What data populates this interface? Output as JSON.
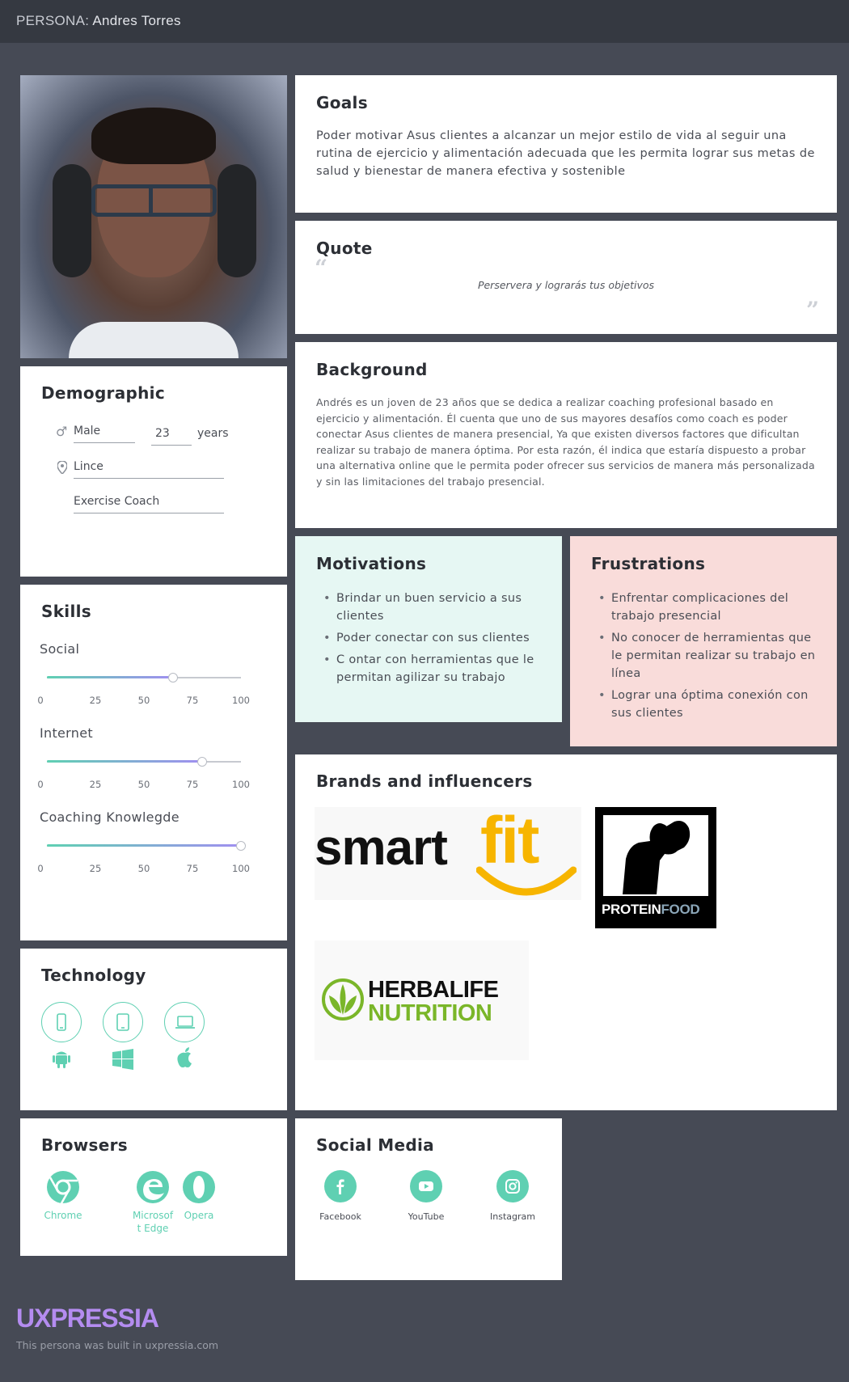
{
  "header": {
    "prefix": "PERSONA:",
    "name": "Andres Torres"
  },
  "goals": {
    "title": "Goals",
    "text": "Poder motivar Asus clientes a alcanzar un mejor estilo de vida al seguir una rutina de ejercicio y alimentación adecuada que les permita lograr sus metas de salud y bienestar de manera efectiva y sostenible"
  },
  "quote": {
    "title": "Quote",
    "text": "Perservera y  lograrás tus objetivos"
  },
  "background": {
    "title": "Background",
    "text": "Andrés es un joven de 23 años que se dedica a realizar coaching profesional basado en ejercicio y alimentación. Él cuenta que uno de sus mayores desafíos como coach es poder conectar Asus clientes de manera presencial, Ya que existen diversos factores que dificultan realizar su trabajo de manera óptima. Por esta razón, él indica que estaría dispuesto a probar una alternativa online que le permita poder ofrecer sus servicios de manera más personalizada y sin las limitaciones del trabajo presencial."
  },
  "demographic": {
    "title": "Demographic",
    "gender": "Male",
    "age": "23",
    "age_unit": "years",
    "location": "Lince",
    "occupation": "Exercise Coach"
  },
  "skills": {
    "title": "Skills",
    "ticks": [
      "0",
      "25",
      "50",
      "75",
      "100"
    ],
    "items": [
      {
        "label": "Social",
        "value": 65
      },
      {
        "label": "Internet",
        "value": 80
      },
      {
        "label": "Coaching Knowlegde",
        "value": 100
      }
    ]
  },
  "motivations": {
    "title": "Motivations",
    "items": [
      "Brindar un buen servicio a sus clientes",
      "Poder conectar con sus clientes",
      " C ontar con herramientas que le permitan agilizar su trabajo"
    ]
  },
  "frustrations": {
    "title": "Frustrations",
    "items": [
      "Enfrentar complicaciones del trabajo presencial",
      "No conocer de herramientas que le permitan realizar su trabajo en línea",
      "Lograr una óptima conexión con sus clientes"
    ]
  },
  "brands": {
    "title": "Brands and influencers",
    "smartfit_a": "smart",
    "smartfit_b": "fit",
    "proteinfood_a": "PROTEIN",
    "proteinfood_b": "FOOD",
    "herbalife_a": "HERBALIFE",
    "herbalife_b": "NUTRITION"
  },
  "technology": {
    "title": "Technology",
    "devices": [
      "smartphone-icon",
      "tablet-icon",
      "laptop-icon"
    ],
    "os": [
      "android-icon",
      "windows-icon",
      "apple-icon"
    ]
  },
  "browsers": {
    "title": "Browsers",
    "items": [
      "Chrome",
      "Microsof t Edge",
      "Opera"
    ],
    "edge_line1": "Microsof",
    "edge_line2": "t Edge"
  },
  "social_media": {
    "title": "Social Media",
    "items": [
      "Facebook",
      "YouTube",
      "Instagram"
    ]
  },
  "footer": {
    "logo": "UXPRESSIA",
    "text": "This persona was built in uxpressia.com"
  },
  "colors": {
    "accent": "#5fd0b2",
    "motivations_bg": "#e6f7f3",
    "frustrations_bg": "#f9dcda",
    "page_bg": "#464a55"
  }
}
